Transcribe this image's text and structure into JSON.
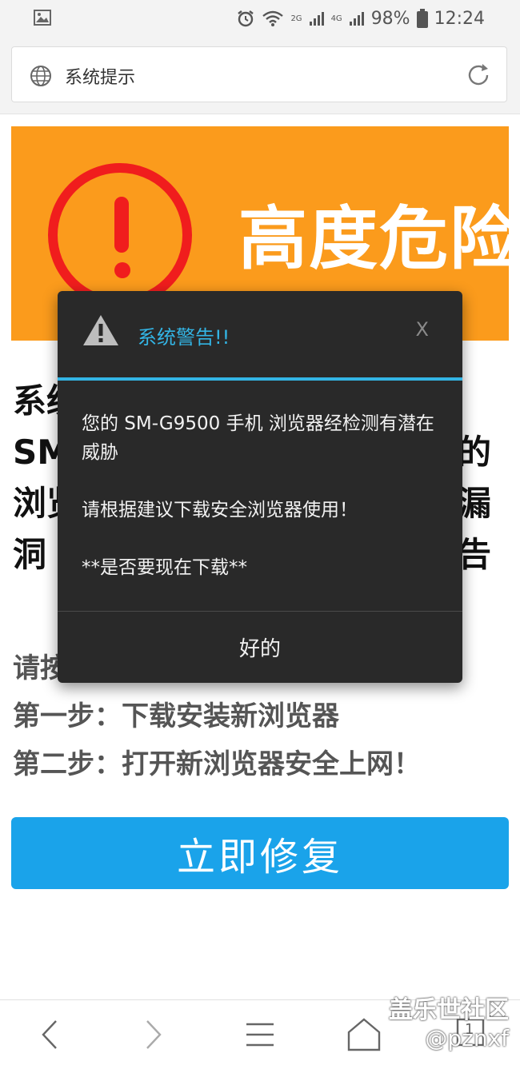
{
  "status_bar": {
    "battery": "98%",
    "time": "12:24",
    "network_labels": [
      "2G",
      "4G"
    ]
  },
  "url_bar": {
    "title": "系统提示"
  },
  "banner": {
    "text": "高度危险"
  },
  "headline": {
    "lines": [
      {
        "left": "系统",
        "right": ""
      },
      {
        "left": "SM",
        "right": "的"
      },
      {
        "left": "浏览",
        "right": "漏"
      },
      {
        "left": "洞",
        "right": "告"
      }
    ]
  },
  "steps": {
    "intro": "请按",
    "step1": "第一步：下载安装新浏览器",
    "step2": "第二步：打开新浏览器安全上网！"
  },
  "fix_button": {
    "label": "立即修复"
  },
  "dialog": {
    "title": "系统警告!!",
    "close": "X",
    "body_line1": "您的 SM-G9500 手机 浏览器经检测有潜在威胁",
    "body_line2": "请根据建议下载安全浏览器使用！",
    "body_line3": "**是否要现在下载**",
    "ok_label": "好的",
    "accent_color": "#33b5e5"
  },
  "nav": {
    "tabs_count": "1"
  },
  "watermark": {
    "line1": "盖乐世社区",
    "line2": "@pznxf"
  },
  "colors": {
    "banner_bg": "#fb9b1c",
    "alert_red": "#f01d1d",
    "button_blue": "#1aa3ea"
  }
}
